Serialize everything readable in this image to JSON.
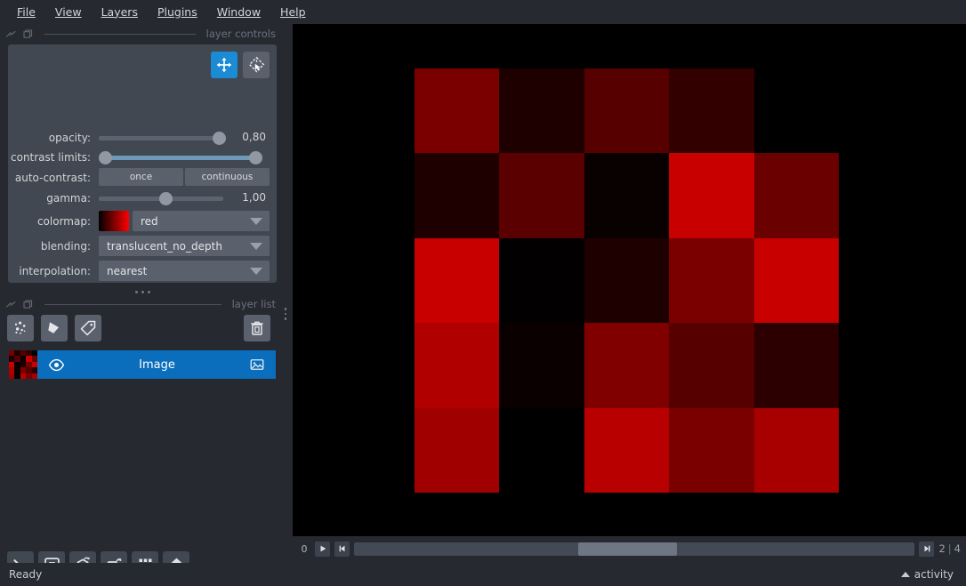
{
  "app": {
    "title": "napari",
    "theme_bg": "#262930",
    "accent": "#0a6ebd"
  },
  "menubar": {
    "items": [
      {
        "label": "File",
        "mnemonic": "F"
      },
      {
        "label": "View",
        "mnemonic": "V"
      },
      {
        "label": "Layers",
        "mnemonic": "L"
      },
      {
        "label": "Plugins",
        "mnemonic": "P"
      },
      {
        "label": "Window",
        "mnemonic": "W"
      },
      {
        "label": "Help",
        "mnemonic": "H"
      }
    ]
  },
  "layer_controls": {
    "dock_title": "layer controls",
    "mode_buttons": [
      {
        "name": "pan-zoom",
        "active": true
      },
      {
        "name": "transform",
        "active": false
      }
    ],
    "opacity": {
      "label": "opacity:",
      "value": "0,80",
      "fraction": 0.8
    },
    "contrast_limits": {
      "label": "contrast limits:",
      "low_fraction": 0.0,
      "high_fraction": 1.0
    },
    "auto_contrast": {
      "label": "auto-contrast:",
      "once_label": "once",
      "continuous_label": "continuous"
    },
    "gamma": {
      "label": "gamma:",
      "value": "1,00",
      "fraction": 0.38
    },
    "colormap": {
      "label": "colormap:",
      "value": "red"
    },
    "blending": {
      "label": "blending:",
      "value": "translucent_no_depth"
    },
    "interpolation": {
      "label": "interpolation:",
      "value": "nearest"
    }
  },
  "layer_list": {
    "dock_title": "layer list",
    "add_buttons": [
      {
        "name": "new-points-layer"
      },
      {
        "name": "new-shapes-layer"
      },
      {
        "name": "new-labels-layer"
      }
    ],
    "delete_button": {
      "name": "delete-layer"
    },
    "layers": [
      {
        "name": "Image",
        "visible": true,
        "selected": true,
        "type": "image"
      }
    ]
  },
  "viewer_buttons": [
    {
      "name": "console",
      "title": "console"
    },
    {
      "name": "roll-dims",
      "title": "roll dimensions"
    },
    {
      "name": "ndisplay-toggle",
      "title": "toggle 2D/3D"
    },
    {
      "name": "transpose-dims",
      "title": "transpose dimensions"
    },
    {
      "name": "grid-view",
      "title": "grid view"
    },
    {
      "name": "home",
      "title": "reset view"
    }
  ],
  "dims": {
    "axis_label": "0",
    "play_button": "play",
    "step_button": "step",
    "last_button": "last",
    "current": "2",
    "separator": "|",
    "max": "4",
    "handle_fraction": 0.4,
    "handle_width_fraction": 0.175
  },
  "statusbar": {
    "status": "Ready",
    "activity_label": "activity"
  },
  "chart_data": {
    "type": "heatmap",
    "title": "",
    "rows": 5,
    "cols": 5,
    "colormap": "red",
    "colors": [
      [
        "#7a0000",
        "#1e0000",
        "#560000",
        "#330000",
        "#000000"
      ],
      [
        "#1f0000",
        "#5a0000",
        "#090000",
        "#c80000",
        "#6b0000"
      ],
      [
        "#c80000",
        "#020000",
        "#1e0000",
        "#7a0000",
        "#c80000"
      ],
      [
        "#b00000",
        "#0a0000",
        "#800000",
        "#560000",
        "#2c0000"
      ],
      [
        "#a00000",
        "#000000",
        "#b80000",
        "#7a0000",
        "#a80000"
      ]
    ],
    "values": [
      [
        0.48,
        0.12,
        0.34,
        0.2,
        0.0
      ],
      [
        0.12,
        0.35,
        0.04,
        0.78,
        0.42
      ],
      [
        0.78,
        0.01,
        0.12,
        0.48,
        0.78
      ],
      [
        0.69,
        0.04,
        0.5,
        0.34,
        0.17
      ],
      [
        0.63,
        0.0,
        0.72,
        0.48,
        0.66
      ]
    ]
  }
}
